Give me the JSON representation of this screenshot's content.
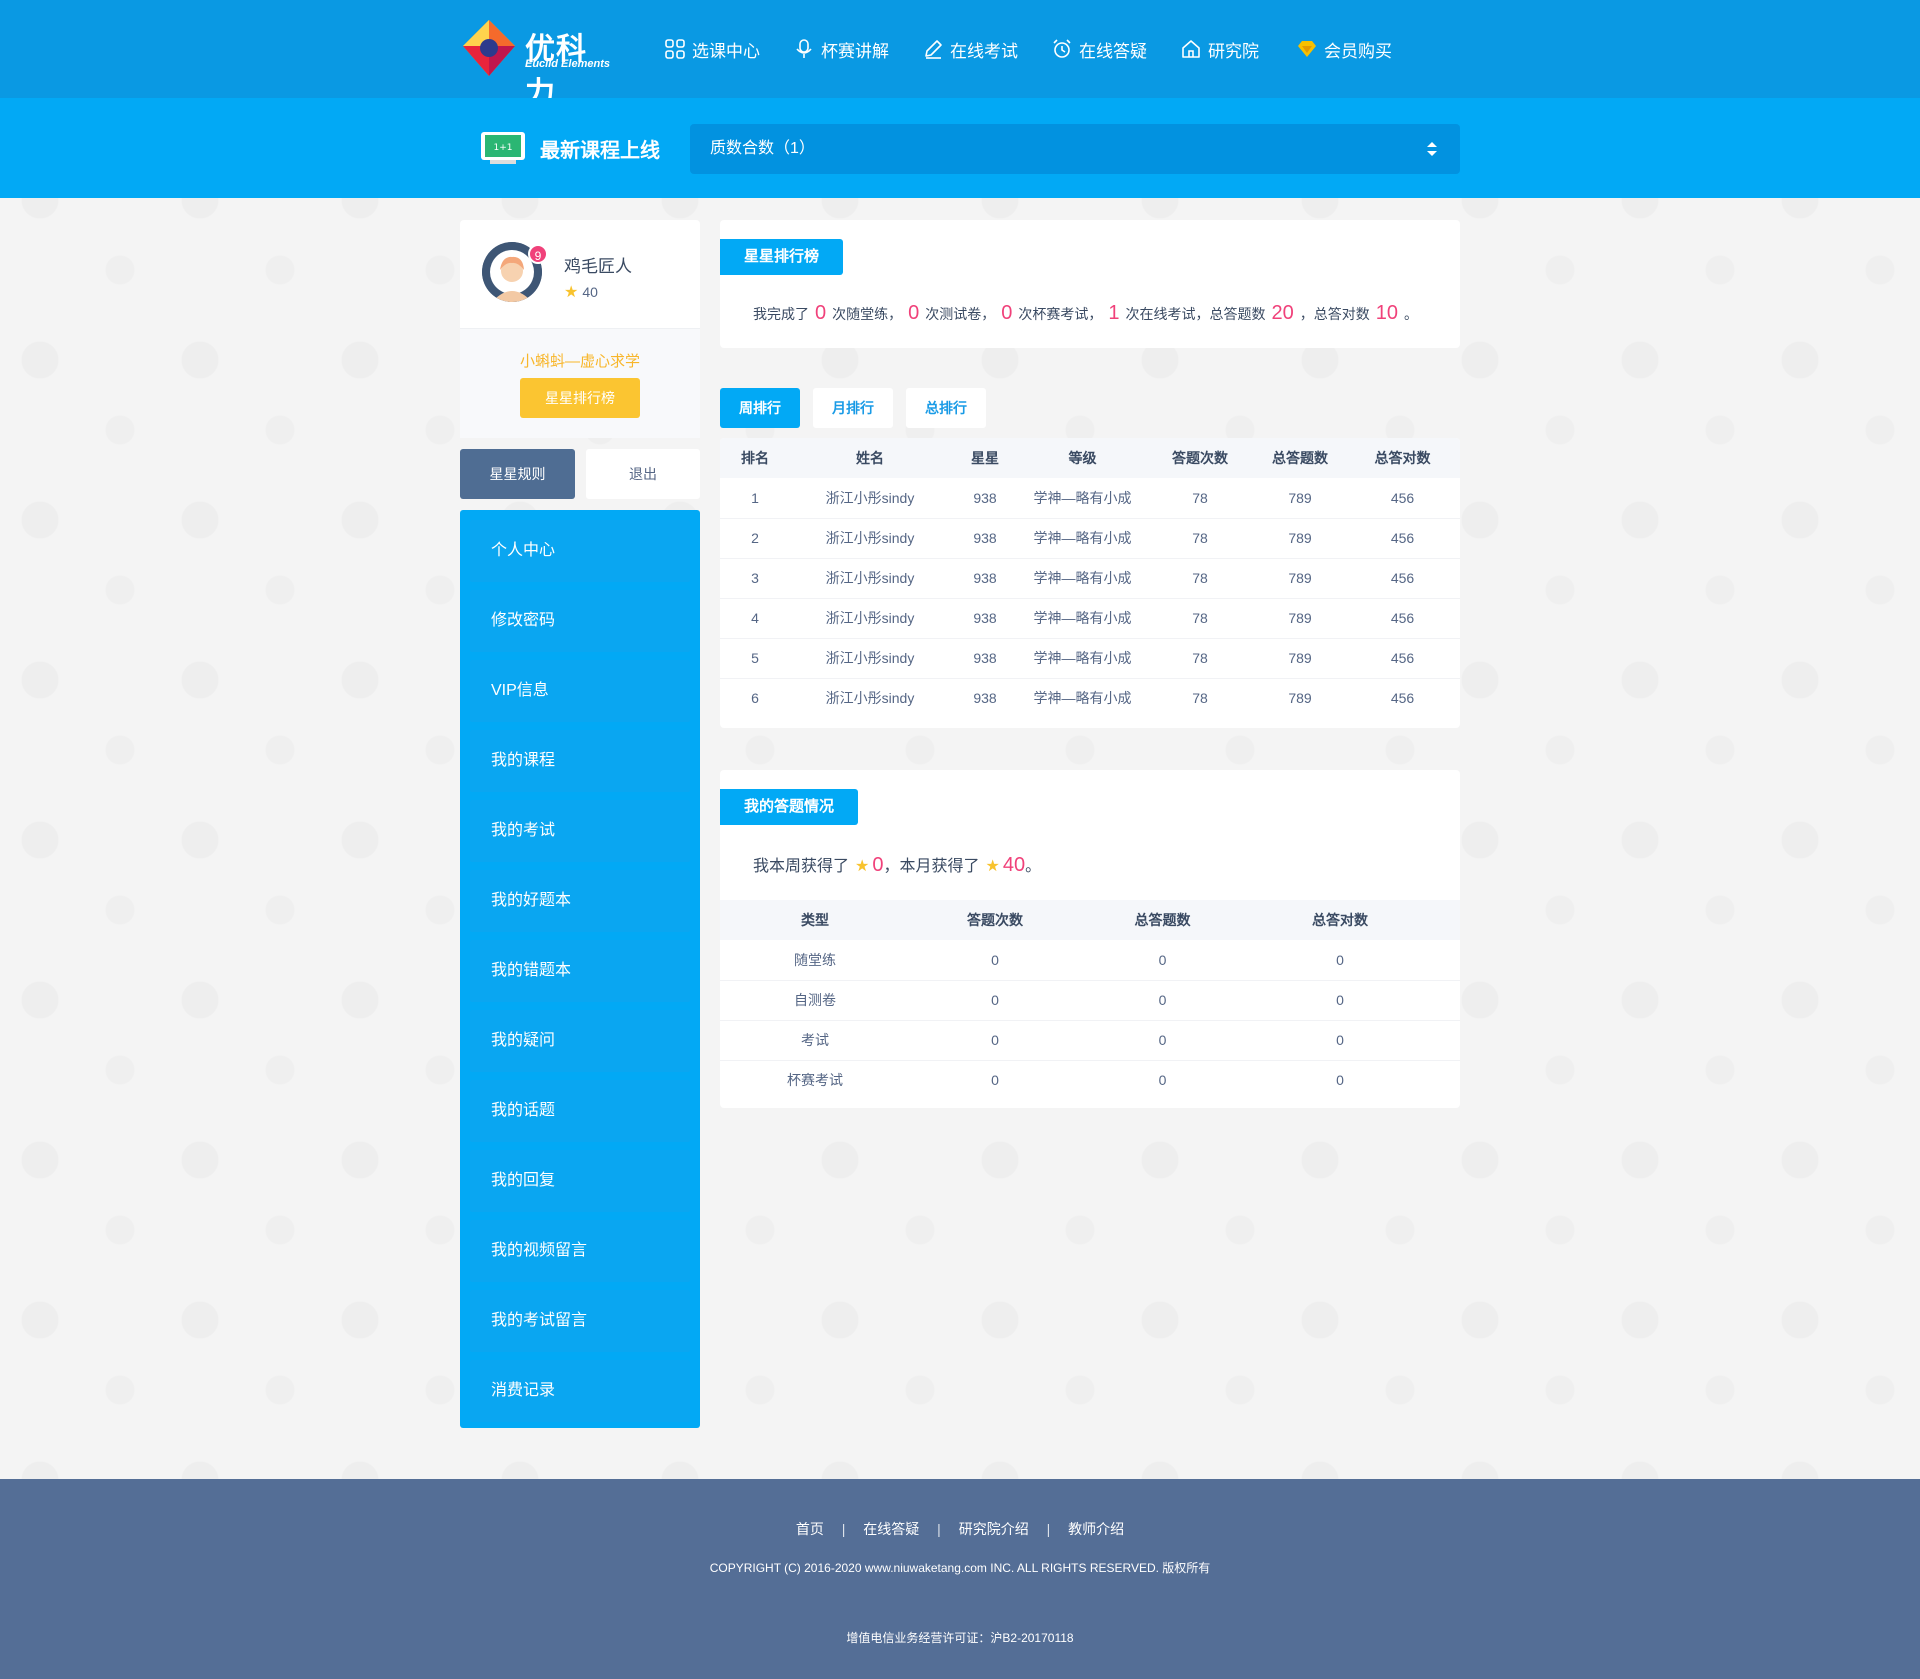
{
  "brand": {
    "name_cn": "优科力",
    "name_en": "Euclid Elements"
  },
  "nav": [
    {
      "label": "选课中心",
      "icon": "grid-icon"
    },
    {
      "label": "杯赛讲解",
      "icon": "microphone-icon"
    },
    {
      "label": "在线考试",
      "icon": "pencil-icon"
    },
    {
      "label": "在线答疑",
      "icon": "alarm-clock-icon"
    },
    {
      "label": "研究院",
      "icon": "house-icon"
    },
    {
      "label": "会员购买",
      "icon": "diamond-icon"
    }
  ],
  "course_bar": {
    "title": "最新课程上线",
    "selected": "质数合数（1）",
    "blackboard_text": "1+1"
  },
  "profile": {
    "name": "鸡毛匠人",
    "badge_count": "9",
    "stars": "40",
    "level": "小蝌蚪—虚心求学",
    "rank_button": "星星排行榜",
    "rule_button": "星星规则",
    "logout_button": "退出"
  },
  "side_menu": [
    "个人中心",
    "修改密码",
    "VIP信息",
    "我的课程",
    "我的考试",
    "我的好题本",
    "我的错题本",
    "我的疑问",
    "我的话题",
    "我的回复",
    "我的视频留言",
    "我的考试留言",
    "消费记录"
  ],
  "ranking_summary": {
    "tag": "星星排行榜",
    "t1": "我完成了",
    "v1": "0",
    "t2": "次随堂练，",
    "v2": "0",
    "t3": "次测试卷，",
    "v3": "0",
    "t4": "次杯赛考试，",
    "v4": "1",
    "t5": "次在线考试，总答题数",
    "v5": "20",
    "t6": "，总答对数",
    "v6": "10",
    "t7": "。"
  },
  "tabs": [
    {
      "label": "周排行",
      "active": true
    },
    {
      "label": "月排行",
      "active": false
    },
    {
      "label": "总排行",
      "active": false
    }
  ],
  "rank_table": {
    "headers": [
      "排名",
      "姓名",
      "星星",
      "等级",
      "答题次数",
      "总答题数",
      "总答对数"
    ],
    "rows": [
      [
        "1",
        "浙江小彤sindy",
        "938",
        "学神—略有小成",
        "78",
        "789",
        "456"
      ],
      [
        "2",
        "浙江小彤sindy",
        "938",
        "学神—略有小成",
        "78",
        "789",
        "456"
      ],
      [
        "3",
        "浙江小彤sindy",
        "938",
        "学神—略有小成",
        "78",
        "789",
        "456"
      ],
      [
        "4",
        "浙江小彤sindy",
        "938",
        "学神—略有小成",
        "78",
        "789",
        "456"
      ],
      [
        "5",
        "浙江小彤sindy",
        "938",
        "学神—略有小成",
        "78",
        "789",
        "456"
      ],
      [
        "6",
        "浙江小彤sindy",
        "938",
        "学神—略有小成",
        "78",
        "789",
        "456"
      ]
    ]
  },
  "my_answers": {
    "tag": "我的答题情况",
    "t1": "我本周获得了",
    "week": "0",
    "t2": "，本月获得了",
    "month": "40",
    "t3": "。",
    "headers": [
      "类型",
      "答题次数",
      "总答题数",
      "总答对数"
    ],
    "rows": [
      [
        "随堂练",
        "0",
        "0",
        "0"
      ],
      [
        "自测卷",
        "0",
        "0",
        "0"
      ],
      [
        "考试",
        "0",
        "0",
        "0"
      ],
      [
        "杯赛考试",
        "0",
        "0",
        "0"
      ]
    ]
  },
  "footer": {
    "links": [
      "首页",
      "在线答疑",
      "研究院介绍",
      "教师介绍"
    ],
    "separator": "|",
    "copyright": "COPYRIGHT (C) 2016-2020 www.niuwaketang.com INC. ALL RIGHTS RESERVED. 版权所有",
    "icp": "增值电信业务经营许可证：沪B2-20170118"
  },
  "colors": {
    "header": "#0a99e3",
    "course_bar": "#02a9f5",
    "accent_pink": "#f0417a",
    "star_yellow": "#f8c32e",
    "footer": "#546e96"
  }
}
